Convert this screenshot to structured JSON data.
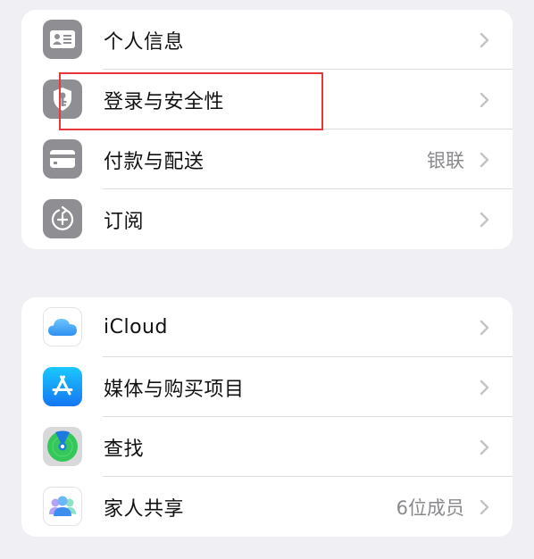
{
  "sections": [
    {
      "items": [
        {
          "label": "个人信息",
          "icon": "contact-card-icon",
          "detail": ""
        },
        {
          "label": "登录与安全性",
          "icon": "shield-key-icon",
          "detail": ""
        },
        {
          "label": "付款与配送",
          "icon": "credit-card-icon",
          "detail": "银联"
        },
        {
          "label": "订阅",
          "icon": "subscription-icon",
          "detail": ""
        }
      ]
    },
    {
      "items": [
        {
          "label": "iCloud",
          "icon": "icloud-icon",
          "detail": ""
        },
        {
          "label": "媒体与购买项目",
          "icon": "app-store-icon",
          "detail": ""
        },
        {
          "label": "查找",
          "icon": "find-my-icon",
          "detail": ""
        },
        {
          "label": "家人共享",
          "icon": "family-sharing-icon",
          "detail": "6位成员"
        }
      ]
    }
  ],
  "highlight": {
    "target": "登录与安全性",
    "color": "#e8383b"
  },
  "colors": {
    "background": "#efeff4",
    "card": "#ffffff",
    "gray_icon": "#8e8e93",
    "detail_text": "#8a8a8e",
    "chevron": "#c4c4c7"
  }
}
